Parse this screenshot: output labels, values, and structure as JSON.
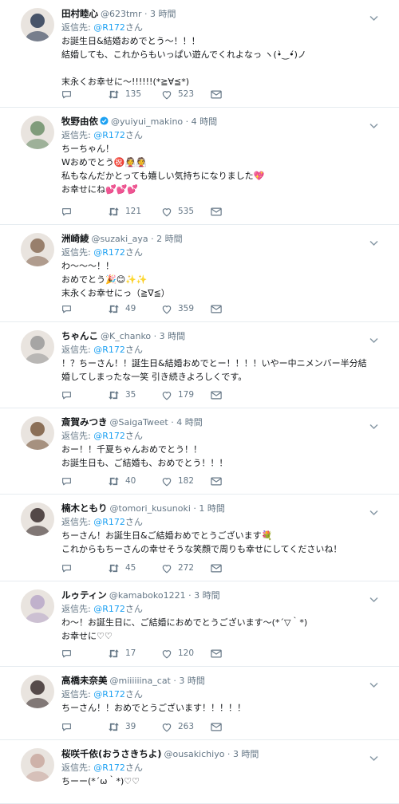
{
  "ui": {
    "replying_label": "返信先:",
    "reply_to": "@R172",
    "reply_suffix": "さん"
  },
  "tweets": [
    {
      "name": "田村睦心",
      "handle": "@623tmr",
      "time": "3 時間",
      "lines": [
        "お誕生日&結婚おめでとう〜！！！",
        "結婚しても、これからもいっぱい遊んでくれよなっ ヽ(•̀‿•́)ノ",
        "",
        "末永くお幸せに〜!!!!!!(*≧∀≦*)"
      ],
      "retweets": "135",
      "likes": "523",
      "verified": false,
      "avatar_color": "#2b3b55"
    },
    {
      "name": "牧野由依",
      "handle": "@yuiyui_makino",
      "time": "4 時間",
      "lines": [
        "ちーちゃん！",
        "Wおめでとう㊗️👰👰",
        "私もなんだかとっても嬉しい気持ちになりました💖",
        "お幸せにね💕💕💕"
      ],
      "retweets": "121",
      "likes": "535",
      "verified": true,
      "avatar_color": "#6d8f6a"
    },
    {
      "name": "洲崎綾",
      "handle": "@suzaki_aya",
      "time": "2 時間",
      "lines": [
        "わ〜〜〜！！",
        "おめでとう🎉😊✨✨",
        "末永くお幸せにっ（≧∇≦）"
      ],
      "retweets": "49",
      "likes": "359",
      "verified": false,
      "avatar_color": "#8a6d58"
    },
    {
      "name": "ちゃんこ",
      "handle": "@K_chanko",
      "time": "3 時間",
      "lines": [
        "！？ちーさん！！誕生日&結婚おめでとー！！！！いやー中ニメンバー半分結婚してしまったな一笑 引き続きよろしくです。"
      ],
      "retweets": "35",
      "likes": "179",
      "verified": false,
      "avatar_color": "#9a9a9a"
    },
    {
      "name": "斎賀みつき",
      "handle": "@SaigaTweet",
      "time": "4 時間",
      "lines": [
        "おー！！千夏ちゃんおめでとう！！",
        "お誕生日も、ご結婚も、おめでとう！！！"
      ],
      "retweets": "40",
      "likes": "182",
      "verified": false,
      "avatar_color": "#7a5a40"
    },
    {
      "name": "楠木ともり",
      "handle": "@tomori_kusunoki",
      "time": "1 時間",
      "lines": [
        "ちーさん！お誕生日&ご結婚おめでとうございます💐",
        "これからもちーさんの幸せそうな笑顔で周りも幸せにしてくださいね！"
      ],
      "retweets": "45",
      "likes": "272",
      "verified": false,
      "avatar_color": "#3a2e2e"
    },
    {
      "name": "ルゥティン",
      "handle": "@kamaboko1221",
      "time": "3 時間",
      "lines": [
        "わ〜！お誕生日に、ご結婚におめでとうございます〜(*´▽｀*)",
        "お幸せに♡♡"
      ],
      "retweets": "17",
      "likes": "120",
      "verified": false,
      "avatar_color": "#b9a8c9"
    },
    {
      "name": "高橋未奈美",
      "handle": "@miiiiiina_cat",
      "time": "3 時間",
      "lines": [
        "ちーさん！！おめでとうございます！！！！！"
      ],
      "retweets": "39",
      "likes": "263",
      "verified": false,
      "avatar_color": "#3c3030"
    },
    {
      "name": "桜咲千依(おうさきちよ)",
      "handle": "@ousakichiyo",
      "time": "3 時間",
      "lines": [
        "ちーー(*´ω｀*)♡♡"
      ],
      "retweets": "",
      "likes": "",
      "verified": false,
      "avatar_color": "#c9a9a0"
    }
  ]
}
